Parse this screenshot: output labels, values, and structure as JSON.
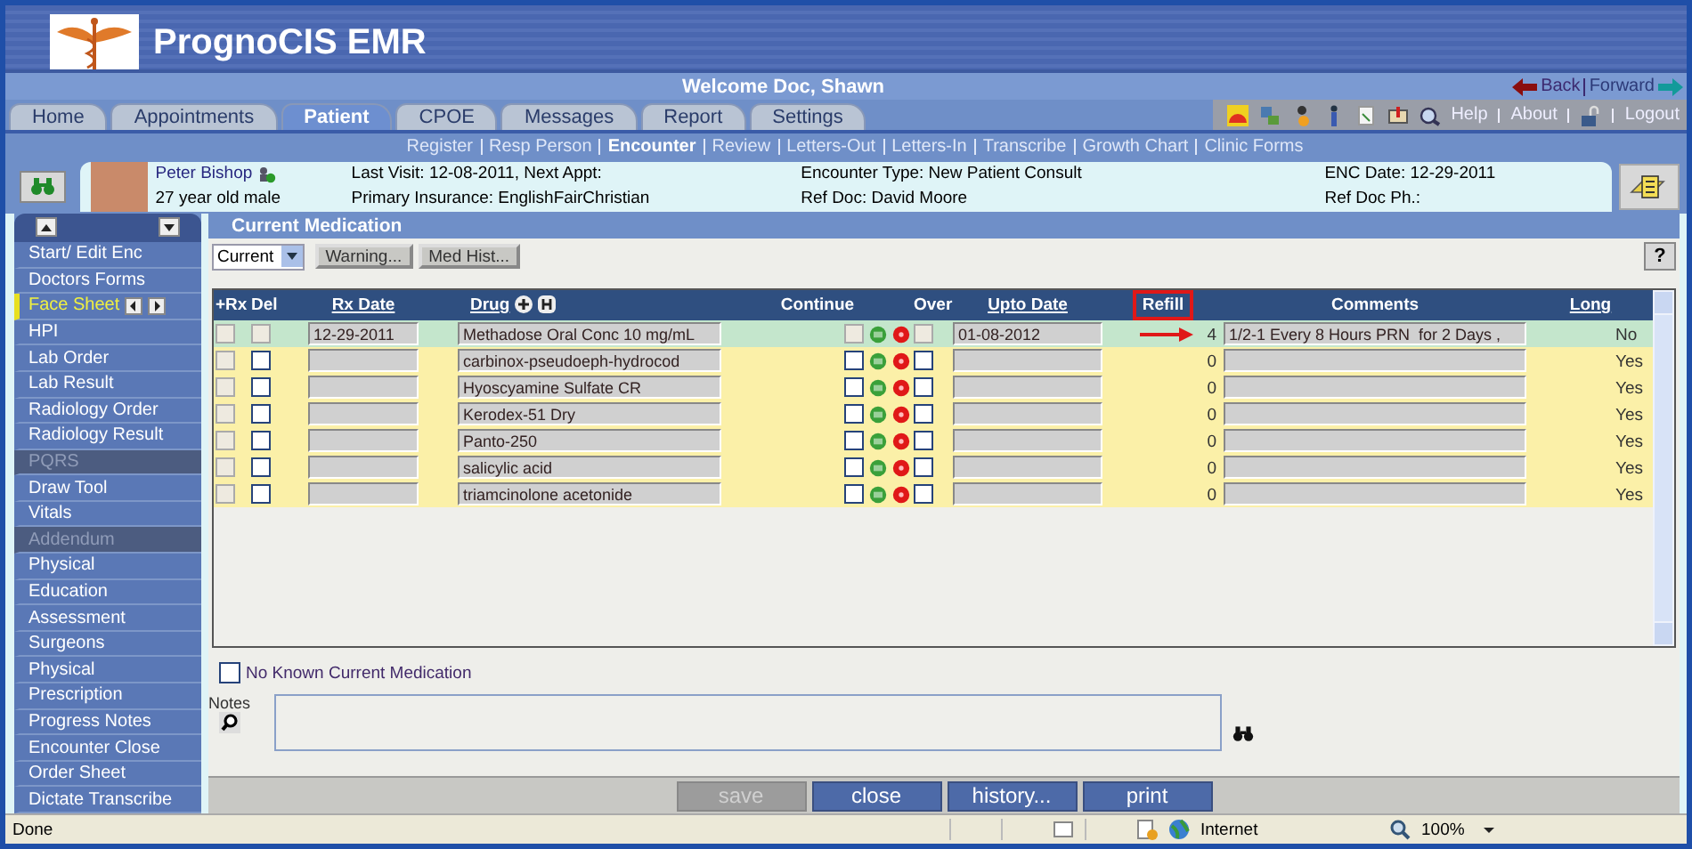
{
  "header": {
    "title": "PrognoCIS EMR",
    "welcome": "Welcome Doc, Shawn",
    "back": "Back",
    "forward": "Forward"
  },
  "tabs": [
    {
      "label": "Home",
      "selected": false
    },
    {
      "label": "Appointments",
      "selected": false
    },
    {
      "label": "Patient",
      "selected": true
    },
    {
      "label": "CPOE",
      "selected": false
    },
    {
      "label": "Messages",
      "selected": false
    },
    {
      "label": "Report",
      "selected": false
    },
    {
      "label": "Settings",
      "selected": false
    }
  ],
  "toolbar": {
    "links": [
      "Help",
      "About"
    ],
    "logout": "Logout"
  },
  "subnav": [
    {
      "label": "Register",
      "selected": false
    },
    {
      "label": "Resp Person",
      "selected": false
    },
    {
      "label": "Encounter",
      "selected": true
    },
    {
      "label": "Review",
      "selected": false
    },
    {
      "label": "Letters-Out",
      "selected": false
    },
    {
      "label": "Letters-In",
      "selected": false
    },
    {
      "label": "Transcribe",
      "selected": false
    },
    {
      "label": "Growth Chart",
      "selected": false
    },
    {
      "label": "Clinic Forms",
      "selected": false
    }
  ],
  "patient": {
    "name": "Peter Bishop",
    "age_sex": "27 year old male",
    "last_visit": "Last Visit: 12-08-2011, Next Appt:",
    "insurance": "Primary Insurance: EnglishFairChristian",
    "encounter_type": "Encounter Type: New Patient Consult",
    "ref_doc": "Ref Doc: David Moore",
    "enc_date": "ENC Date: 12-29-2011",
    "ref_doc_ph": "Ref Doc Ph.:"
  },
  "sidebar": [
    {
      "label": "Start/ Edit Enc",
      "kind": "link",
      "selected": false
    },
    {
      "label": "Doctors Forms",
      "kind": "link",
      "selected": false
    },
    {
      "label": "Face Sheet",
      "kind": "link",
      "selected": true
    },
    {
      "label": "HPI",
      "kind": "link",
      "selected": false
    },
    {
      "label": "Lab Order",
      "kind": "link",
      "selected": false
    },
    {
      "label": "Lab Result",
      "kind": "link",
      "selected": false
    },
    {
      "label": "Radiology Order",
      "kind": "link",
      "selected": false
    },
    {
      "label": "Radiology Result",
      "kind": "link",
      "selected": false
    },
    {
      "label": "PQRS",
      "kind": "header",
      "selected": false
    },
    {
      "label": "Draw Tool",
      "kind": "link",
      "selected": false
    },
    {
      "label": "Vitals",
      "kind": "link",
      "selected": false
    },
    {
      "label": "Addendum",
      "kind": "header",
      "selected": false
    },
    {
      "label": "Physical",
      "kind": "link",
      "selected": false
    },
    {
      "label": "Education",
      "kind": "link",
      "selected": false
    },
    {
      "label": "Assessment",
      "kind": "link",
      "selected": false
    },
    {
      "label": "Surgeons",
      "kind": "link",
      "selected": false
    },
    {
      "label": "Physical",
      "kind": "link",
      "selected": false
    },
    {
      "label": "Prescription",
      "kind": "link",
      "selected": false
    },
    {
      "label": "Progress Notes",
      "kind": "link",
      "selected": false
    },
    {
      "label": "Encounter Close",
      "kind": "link",
      "selected": false
    },
    {
      "label": "Order Sheet",
      "kind": "link",
      "selected": false
    },
    {
      "label": "Dictate Transcribe",
      "kind": "link",
      "selected": false
    }
  ],
  "panel": {
    "title": "Current Medication",
    "filter": "Current",
    "buttons": [
      "Warning...",
      "Med Hist..."
    ],
    "help": "?"
  },
  "table": {
    "columns": [
      {
        "label": "+Rx",
        "sortable": false,
        "highlighted": false
      },
      {
        "label": "Del",
        "sortable": false,
        "highlighted": false
      },
      {
        "label": "Rx Date",
        "sortable": true,
        "highlighted": false
      },
      {
        "label": "Drug",
        "sortable": true,
        "highlighted": false
      },
      {
        "label": "Continue",
        "sortable": false,
        "highlighted": false
      },
      {
        "label": "Over",
        "sortable": false,
        "highlighted": false
      },
      {
        "label": "Upto Date",
        "sortable": true,
        "highlighted": false
      },
      {
        "label": "Refill",
        "sortable": false,
        "highlighted": true
      },
      {
        "label": "Comments",
        "sortable": false,
        "highlighted": false
      },
      {
        "label": "Long",
        "sortable": true,
        "highlighted": false
      }
    ],
    "rows": [
      {
        "prescribed": true,
        "arrow": true,
        "rx_date": "12-29-2011",
        "drug": "Methadose Oral Conc 10 mg/mL",
        "upto_date": "01-08-2012",
        "refill": "4",
        "comments": "1/2-1 Every 8 Hours PRN  for 2 Days ,",
        "long": "No"
      },
      {
        "prescribed": false,
        "arrow": false,
        "drug": "carbinox-pseudoeph-hydrocod",
        "refill": "0",
        "long": "Yes"
      },
      {
        "prescribed": false,
        "arrow": false,
        "drug": "Hyoscyamine Sulfate CR",
        "refill": "0",
        "long": "Yes"
      },
      {
        "prescribed": false,
        "arrow": false,
        "drug": "Kerodex-51 Dry",
        "refill": "0",
        "long": "Yes"
      },
      {
        "prescribed": false,
        "arrow": false,
        "drug": "Panto-250",
        "refill": "0",
        "long": "Yes"
      },
      {
        "prescribed": false,
        "arrow": false,
        "drug": "salicylic acid",
        "refill": "0",
        "long": "Yes"
      },
      {
        "prescribed": false,
        "arrow": false,
        "drug": "triamcinolone acetonide",
        "refill": "0",
        "long": "Yes"
      }
    ]
  },
  "no_known": {
    "label": "No Known Current Medication",
    "checked": false
  },
  "notes": {
    "label": "Notes"
  },
  "buttons": [
    {
      "label": "save",
      "disabled": true
    },
    {
      "label": "close",
      "disabled": false
    },
    {
      "label": "history...",
      "disabled": false
    },
    {
      "label": "print",
      "disabled": false
    }
  ],
  "status_bar": {
    "text": "Done",
    "zone": "Internet",
    "zoom": "100%"
  }
}
